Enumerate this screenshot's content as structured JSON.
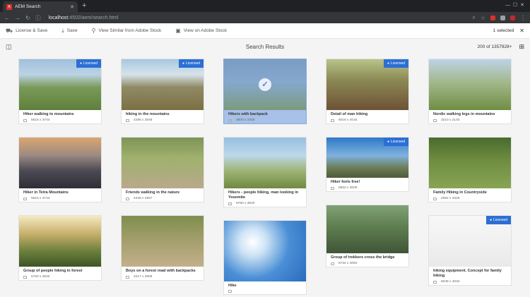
{
  "browser": {
    "tab_title": "AEM Search",
    "url_host": "localhost",
    "url_rest": ":4502/aem/search.html"
  },
  "toolbar": {
    "license_label": "License & Save",
    "save_label": "Save",
    "similar_label": "View Similar from Adobe Stock",
    "view_label": "View on Adobe Stock",
    "selected_label": "1 selected"
  },
  "results": {
    "title": "Search Results",
    "count": "200 of 1357928+"
  },
  "badge_label": "Licensed",
  "cards": [
    {
      "caption": "Hiker walking to mountains",
      "dims": "5616 x 3744",
      "licensed": true,
      "selected": false
    },
    {
      "caption": "hiking in the mountains",
      "dims": "4288 x 2846",
      "licensed": true,
      "selected": false
    },
    {
      "caption": "Hikers with backpack",
      "dims": "3600 x 2400",
      "licensed": false,
      "selected": true
    },
    {
      "caption": "Detail of man hiking",
      "dims": "6016 x 4016",
      "licensed": true,
      "selected": false
    },
    {
      "caption": "Nordic walking legs in mountains",
      "dims": "3210 x 2140",
      "licensed": false,
      "selected": false
    },
    {
      "caption": "Hiker in Tetra Mountains",
      "dims": "5616 x 3744",
      "licensed": false,
      "selected": false
    },
    {
      "caption": "Friends walking in the nature",
      "dims": "4429 x 2957",
      "licensed": false,
      "selected": false
    },
    {
      "caption": "Hikers - people hiking, man looking in Yosemite",
      "dims": "5760 x 3840",
      "licensed": false,
      "selected": false
    },
    {
      "caption": "Hiker feels free!",
      "dims": "5652 x 3000",
      "licensed": true,
      "selected": false
    },
    {
      "caption": "Family Hiking in Countryside",
      "dims": "4992 x 3328",
      "licensed": false,
      "selected": false
    },
    {
      "caption": "Group of people hiking in forest",
      "dims": "5760 x 3840",
      "licensed": false,
      "selected": false
    },
    {
      "caption": "Boys on a forest road with backpacks",
      "dims": "4217 x 2806",
      "licensed": false,
      "selected": false
    },
    {
      "caption": "Hike",
      "dims": "",
      "licensed": false,
      "selected": false
    },
    {
      "caption": "Group of trekkers cross the bridge",
      "dims": "5734 x 3084",
      "licensed": false,
      "selected": false
    },
    {
      "caption": "hiking equipment. Concept for family hiking",
      "dims": "6048 x 4032",
      "licensed": true,
      "selected": false
    }
  ]
}
